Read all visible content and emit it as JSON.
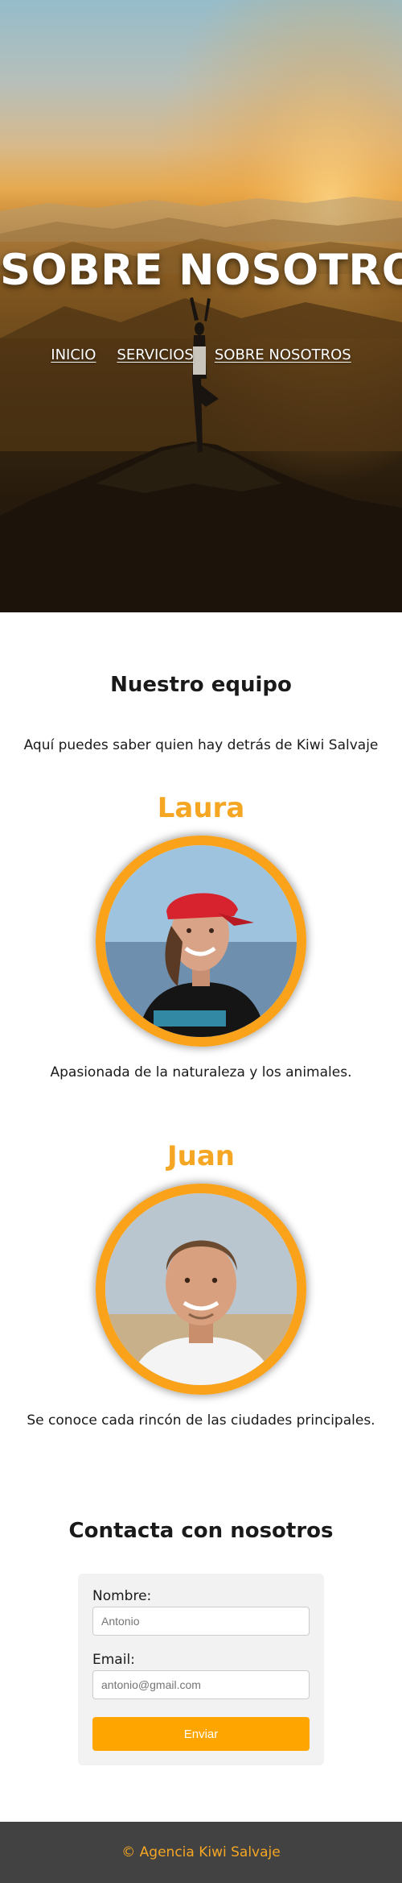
{
  "hero": {
    "title": "SOBRE NOSOTROS",
    "nav": [
      {
        "label": "INICIO"
      },
      {
        "label": "SERVICIOS"
      },
      {
        "label": "SOBRE NOSOTROS"
      }
    ]
  },
  "team": {
    "heading": "Nuestro equipo",
    "intro": "Aquí puedes saber quien hay detrás de Kiwi Salvaje",
    "members": [
      {
        "name": "Laura",
        "description": "Apasionada de la naturaleza y los animales."
      },
      {
        "name": "Juan",
        "description": "Se conoce cada rincón de las ciudades principales."
      }
    ]
  },
  "contact": {
    "heading": "Contacta con nosotros",
    "name_label": "Nombre:",
    "name_placeholder": "Antonio",
    "email_label": "Email:",
    "email_placeholder": "antonio@gmail.com",
    "submit_label": "Enviar"
  },
  "footer": {
    "text": "© Agencia Kiwi Salvaje"
  },
  "colors": {
    "accent": "#f5a623",
    "button": "#ffa500",
    "footer_bg": "#424242"
  }
}
